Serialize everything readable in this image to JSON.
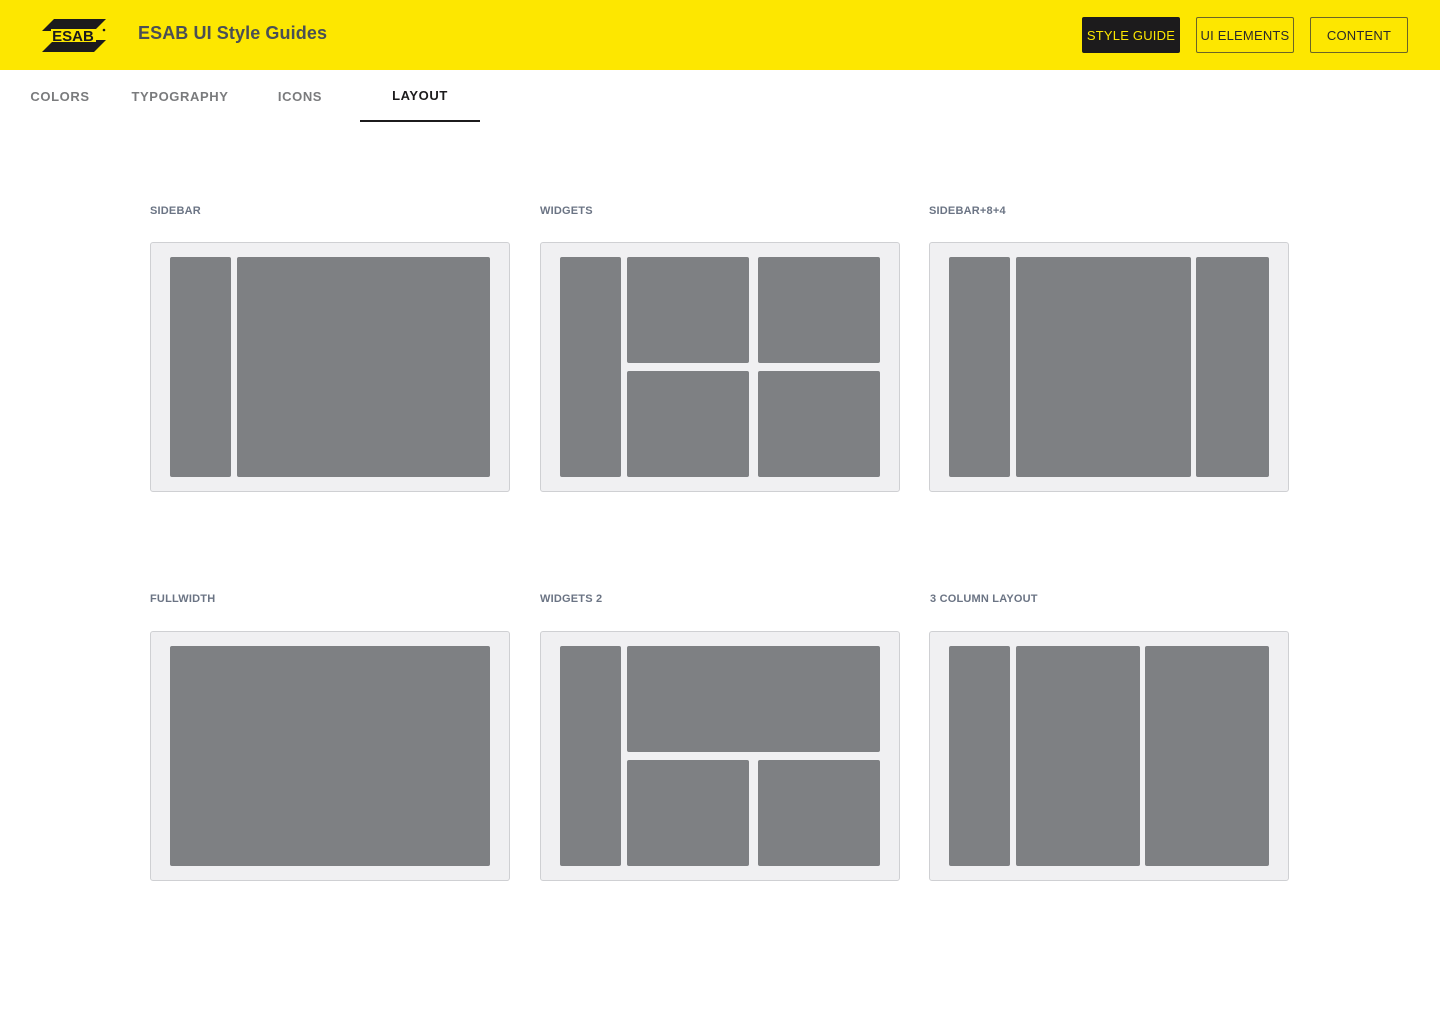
{
  "header": {
    "logo_text": "ESAB",
    "logo_icon": "esab-logo-icon",
    "title": "ESAB UI Style Guides",
    "buttons": [
      {
        "label": "STYLE GUIDE",
        "active": true
      },
      {
        "label": "UI ELEMENTS",
        "active": false
      },
      {
        "label": "CONTENT",
        "active": false
      }
    ]
  },
  "tabs": [
    {
      "label": "COLORS",
      "active": false
    },
    {
      "label": "TYPOGRAPHY",
      "active": false
    },
    {
      "label": "ICONS",
      "active": false
    },
    {
      "label": "LAYOUT",
      "active": true
    }
  ],
  "layouts": [
    {
      "label": "SIDEBAR"
    },
    {
      "label": "WIDGETS"
    },
    {
      "label": "SIDEBAR+8+4"
    },
    {
      "label": "FULLWIDTH"
    },
    {
      "label": "WIDGETS 2"
    },
    {
      "label": "3 COLUMN LAYOUT"
    }
  ],
  "colors": {
    "brand_yellow": "#fde700",
    "active_button_bg": "#1c1b1c",
    "layout_block": "#7e8083",
    "layout_card_bg": "#f0f0f2"
  }
}
